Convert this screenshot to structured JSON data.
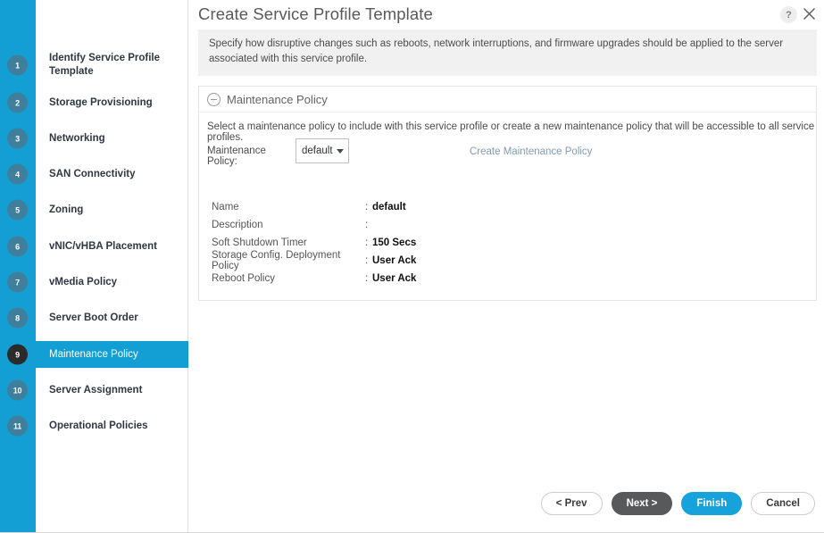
{
  "dialog": {
    "title": "Create Service Profile Template",
    "help_icon": "question-mark-icon",
    "close_icon": "close-icon",
    "intro": "Specify how disruptive changes such as reboots, network interruptions, and firmware upgrades should be applied to the server associated with this service profile."
  },
  "wizard": {
    "active_index": 8,
    "steps": [
      {
        "number": "1",
        "label": "Identify Service Profile Template"
      },
      {
        "number": "2",
        "label": "Storage Provisioning"
      },
      {
        "number": "3",
        "label": "Networking"
      },
      {
        "number": "4",
        "label": "SAN Connectivity"
      },
      {
        "number": "5",
        "label": "Zoning"
      },
      {
        "number": "6",
        "label": "vNIC/vHBA Placement"
      },
      {
        "number": "7",
        "label": "vMedia Policy"
      },
      {
        "number": "8",
        "label": "Server Boot Order"
      },
      {
        "number": "9",
        "label": "Maintenance Policy"
      },
      {
        "number": "10",
        "label": "Server Assignment"
      },
      {
        "number": "11",
        "label": "Operational Policies"
      }
    ]
  },
  "section": {
    "title": "Maintenance Policy",
    "collapse_icon": "minus-circle-icon",
    "hint": "Select a maintenance policy to include with this service profile or create a new maintenance policy that will be accessible to all service profiles.",
    "policy_label": "Maintenance Policy:",
    "policy_value": "default",
    "policy_options": [
      "default"
    ],
    "create_link": "Create Maintenance Policy",
    "details": [
      {
        "key": "Name",
        "value": "default"
      },
      {
        "key": "Description",
        "value": ""
      },
      {
        "key": "Soft Shutdown Timer",
        "value": "150 Secs"
      },
      {
        "key": "Storage Config. Deployment Policy",
        "value": "User Ack"
      },
      {
        "key": "Reboot Policy",
        "value": "User Ack"
      }
    ]
  },
  "footer": {
    "prev": "< Prev",
    "next": "Next >",
    "finish": "Finish",
    "cancel": "Cancel"
  },
  "colors": {
    "rail_blue": "#149fd4",
    "accent_blue": "#17a2db",
    "badge_blue": "#3f7f9b",
    "badge_active": "#2b2b2b",
    "dark_button": "#58595b",
    "link_blue": "#7f9cb5"
  }
}
